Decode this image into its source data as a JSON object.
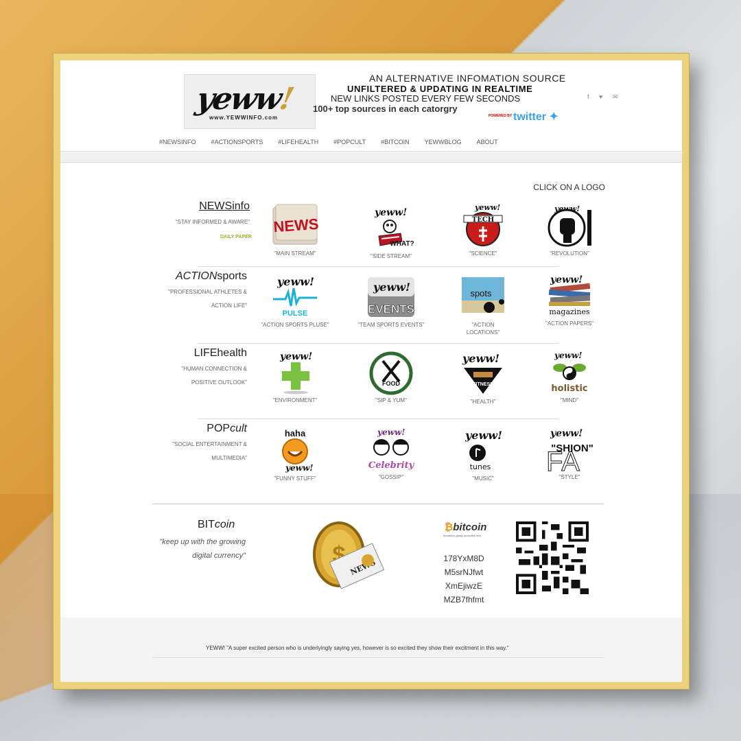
{
  "header": {
    "logo_text": "yeww",
    "logo_bang": "!",
    "logo_url": "www.YEWWINFO.com",
    "tagline_1": "AN ALTERNATIVE INFOMATION SOURCE",
    "tagline_2": "UNFILTERED & UPDATING IN REALTIME",
    "tagline_3": "NEW LINKS POSTED EVERY FEW SECONDS",
    "tagline_4": "100+ top sources in each catorgry",
    "powered_by": "POWERED BY",
    "twitter": "twitter",
    "social_icons": [
      "facebook-icon",
      "twitter-icon",
      "email-icon"
    ],
    "social_glyphs": "f ♥ ✉"
  },
  "nav": [
    "#NEWSINFO",
    "#ACTIONSPORTS",
    "#LIFEHEALTH",
    "#POPCULT",
    "#BITCOIN",
    "YEWWBLOG",
    "ABOUT"
  ],
  "click_on_logo": "CLICK ON A LOGO",
  "categories": [
    {
      "title_main": "NEWS",
      "title_rest": "info",
      "subtitle_1": "\"STAY INFORMED & AWARE\"",
      "subtitle_2": "",
      "extra": "DAILY PAPER",
      "tiles": [
        {
          "label": "\"MAIN STREAM\"",
          "icon": "news-paper-logo",
          "text": "NEWS"
        },
        {
          "label": "\"SIDE STREAM\"",
          "icon": "what-face-logo",
          "text": "WHAT?"
        },
        {
          "label": "\"SCIENCE\"",
          "icon": "tech-logo",
          "text": "TECH"
        },
        {
          "label": "\"REVOLUTION\"",
          "icon": "revolution-fist-logo",
          "text": ""
        }
      ]
    },
    {
      "title_main": "ACTION",
      "title_rest": "sports",
      "subtitle_1": "\"PROFESSIONAL ATHLETES &",
      "subtitle_2": "ACTION LIFE\"",
      "extra": "",
      "tiles": [
        {
          "label": "\"ACTION SPORTS PLUSE\"",
          "icon": "pulse-logo",
          "text": "PULSE"
        },
        {
          "label": "\"TEAM SPORTS EVENTS\"",
          "icon": "events-logo",
          "text": "EVENTS"
        },
        {
          "label": "\"ACTION LOCATIONS\"",
          "icon": "spots-logo",
          "text": "spots"
        },
        {
          "label": "\"ACTION PAPERS\"",
          "icon": "magazines-logo",
          "text": "magazines"
        }
      ]
    },
    {
      "title_main": "LIFE",
      "title_rest": "health",
      "subtitle_1": "\"HUMAN CONNECTION &",
      "subtitle_2": "POSITIVE OUTLOOK\"",
      "extra": "",
      "tiles": [
        {
          "label": "\"ENVIRONMENT\"",
          "icon": "green-cross-logo",
          "text": "+"
        },
        {
          "label": "\"SIP & YUM\"",
          "icon": "food-logo",
          "text": "FOOD"
        },
        {
          "label": "\"HEALTH\"",
          "icon": "fitness-logo",
          "text": "FITNESS"
        },
        {
          "label": "\"MIND\"",
          "icon": "holistic-logo",
          "text": "holistic"
        }
      ]
    },
    {
      "title_main": "POP",
      "title_rest": "cult",
      "subtitle_1": "\"SOCIAL ENTERTAINMENT &",
      "subtitle_2": "MULTIMEDIA\"",
      "extra": "",
      "tiles": [
        {
          "label": "\"FUNNY STUFF\"",
          "icon": "haha-logo",
          "text": "haha"
        },
        {
          "label": "\"GOSSIP\"",
          "icon": "celebrity-logo",
          "text": "Celebrity"
        },
        {
          "label": "\"MUSIC\"",
          "icon": "tunes-logo",
          "text": "tunes"
        },
        {
          "label": "\"STYLE\"",
          "icon": "fashion-logo",
          "text": "\"SHION\""
        }
      ]
    }
  ],
  "bitcoin": {
    "title_main": "BIT",
    "title_rest": "coin",
    "subtitle": "\"keep up with the growing digital currency\"",
    "logo": "bitcoin",
    "logo_tag": "donations gladly accepted here",
    "address_lines": [
      "178YxM8D",
      "M5srNJfwt",
      "XmEjiwzE",
      "MZB7fhfmt"
    ],
    "coin_text": "NEWS"
  },
  "footer": {
    "quote": "YEWW!   \"A super excited person who is underlyingly saying yes, however is so excited they show their excitment in this way.\""
  },
  "colors": {
    "accent_gold": "#c8a238",
    "twitter_blue": "#38a1f3",
    "daily_green": "#9bb22a",
    "bitcoin_orange": "#f7931a"
  }
}
